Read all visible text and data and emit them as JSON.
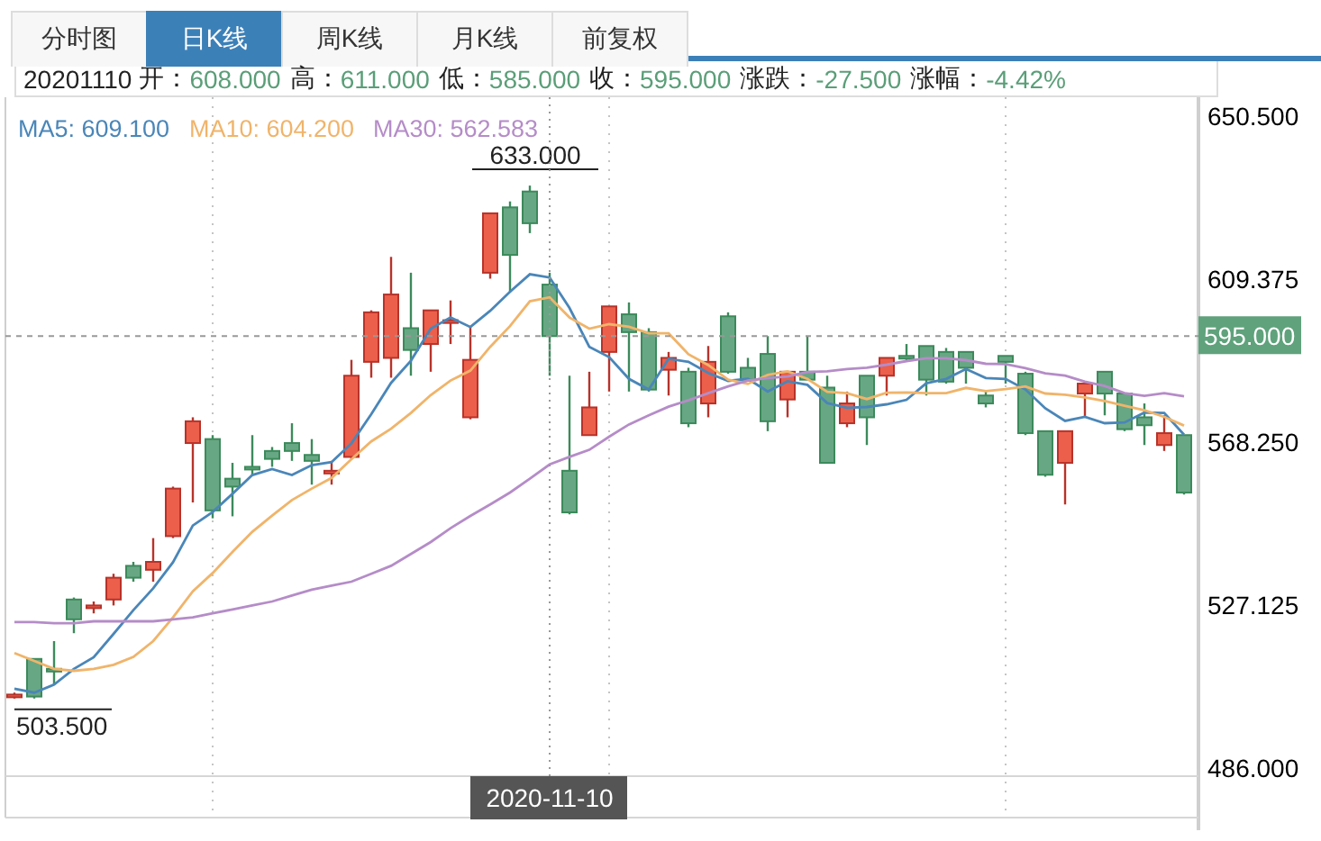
{
  "tabs": [
    {
      "label": "分时图",
      "selected": false
    },
    {
      "label": "日K线",
      "selected": true
    },
    {
      "label": "周K线",
      "selected": false
    },
    {
      "label": "月K线",
      "selected": false
    },
    {
      "label": "前复权",
      "selected": false
    }
  ],
  "quote": {
    "date": "20201110",
    "fields": [
      {
        "label": "开：",
        "value": "608.000"
      },
      {
        "label": "高：",
        "value": "611.000"
      },
      {
        "label": "低：",
        "value": "585.000"
      },
      {
        "label": "收：",
        "value": "595.000"
      },
      {
        "label": "涨跌：",
        "value": "-27.500"
      },
      {
        "label": "涨幅：",
        "value": "-4.42%"
      }
    ]
  },
  "chart": {
    "max_label": "633.000",
    "min_label": "503.500",
    "cursor_date": "2020-11-10",
    "chart_data": {
      "type": "candlestick",
      "ylim": [
        483.9,
        655.3
      ],
      "grid": true,
      "yticks": [
        {
          "value": 650.5,
          "label": "650.500"
        },
        {
          "value": 609.375,
          "label": "609.375"
        },
        {
          "value": 568.25,
          "label": "568.250"
        },
        {
          "value": 527.125,
          "label": "527.125"
        },
        {
          "value": 486,
          "label": "486.000"
        }
      ],
      "series": [
        {
          "name": "MA5: 609.100",
          "type": "line",
          "color": "#4a86b8",
          "values": [
            506,
            505,
            507,
            511,
            513.9,
            519.8,
            525.8,
            531.3,
            537.9,
            547.2,
            550.6,
            555.2,
            559.9,
            561.4,
            559.9,
            562.4,
            563.2,
            567.9,
            575.3,
            583.2,
            588.8,
            596.9,
            599.7,
            597.3,
            601.4,
            606.2,
            610.6,
            609.8,
            602.1,
            592.3,
            589.7,
            584.2,
            581.5,
            589.3,
            588.5,
            585.7,
            583.7,
            584.2,
            581,
            583.6,
            582.7,
            578.1,
            576.9,
            577.1,
            577.8,
            578.9,
            583.1,
            584.2,
            586.7,
            584.4,
            584.2,
            581.5,
            576.8,
            573.6,
            574.6,
            573,
            573.2,
            575.7,
            575.6,
            570.1
          ]
        },
        {
          "name": "MA10: 604.200",
          "type": "line",
          "color": "#f0b46a",
          "values": [
            515,
            513,
            511,
            510.5,
            511,
            512,
            514,
            518,
            524,
            530.6,
            535.2,
            540.5,
            545.6,
            549.7,
            553.6,
            556.5,
            559.2,
            563.9,
            568.4,
            571.6,
            575.6,
            580.1,
            583.8,
            586.3,
            592.3,
            597.5,
            603.8,
            604.8,
            599.7,
            596.9,
            598,
            597.4,
            595.7,
            595.7,
            590.4,
            587.7,
            584,
            582.9,
            585.2,
            586.1,
            584.2,
            580.9,
            580.6,
            579.1,
            580.7,
            580.8,
            580.6,
            580.6,
            581.9,
            581.1,
            581.6,
            582.3,
            580.5,
            580.2,
            579.5,
            578.6,
            577.4,
            576.3,
            574.6,
            572.4
          ]
        },
        {
          "name": "MA30: 562.583",
          "type": "line",
          "color": "#b58cc8",
          "values": [
            522.8,
            522.8,
            522.5,
            522.5,
            523,
            523,
            523,
            523,
            523.5,
            524,
            525,
            526,
            527,
            528,
            529.5,
            531,
            532,
            533,
            535,
            537,
            540,
            543,
            546.5,
            549.6,
            552.5,
            555.5,
            559,
            562.6,
            564.5,
            566.3,
            569.6,
            572.7,
            575,
            577.2,
            578.8,
            580.6,
            582.3,
            583.8,
            584.4,
            584.8,
            585.9,
            586.1,
            586.7,
            587,
            587.8,
            588.7,
            589.4,
            589.4,
            588.9,
            588,
            587.9,
            586.9,
            585.6,
            585,
            583.5,
            582.4,
            580.6,
            579.9,
            580.6,
            579.8
          ]
        }
      ],
      "ohlc": [
        [
          504,
          505,
          503.5,
          504.5
        ],
        [
          513.5,
          513.5,
          503.5,
          504
        ],
        [
          511,
          518,
          507,
          510.5
        ],
        [
          528.5,
          529,
          520,
          523.5
        ],
        [
          526.5,
          528,
          525,
          527
        ],
        [
          528.5,
          535,
          527,
          534
        ],
        [
          537,
          538,
          533,
          534
        ],
        [
          536,
          544,
          533,
          538
        ],
        [
          544.5,
          557,
          544,
          556.5
        ],
        [
          568,
          574.5,
          553,
          573.5
        ],
        [
          569,
          570,
          549,
          551
        ],
        [
          559,
          563,
          549.5,
          557
        ],
        [
          562,
          570,
          560,
          561.5
        ],
        [
          566,
          567,
          562,
          564
        ],
        [
          568,
          573,
          563.5,
          566
        ],
        [
          565,
          569,
          557.5,
          563.5
        ],
        [
          560.5,
          563.5,
          557.5,
          561
        ],
        [
          564.5,
          589,
          564,
          585
        ],
        [
          588.5,
          601.5,
          584.5,
          601
        ],
        [
          589.5,
          615,
          584.5,
          605.5
        ],
        [
          597,
          611,
          585,
          591.5
        ],
        [
          593,
          601.5,
          586,
          601.5
        ],
        [
          598.5,
          604,
          593,
          599
        ],
        [
          574.5,
          597.5,
          574,
          589
        ],
        [
          611,
          626,
          609.5,
          626
        ],
        [
          627.5,
          629,
          606,
          615.5
        ],
        [
          631.5,
          633,
          621,
          623.5
        ],
        [
          608,
          611,
          585,
          595
        ],
        [
          561,
          585,
          550,
          550.5
        ],
        [
          570,
          586,
          570,
          577
        ],
        [
          591,
          602.5,
          581,
          602.5
        ],
        [
          600.5,
          603.5,
          581,
          596
        ],
        [
          596,
          597,
          581,
          581.5
        ],
        [
          586.5,
          591,
          580,
          589.5
        ],
        [
          586,
          587,
          572,
          573
        ],
        [
          578,
          592.5,
          574.5,
          588.5
        ],
        [
          600,
          601,
          585.5,
          586
        ],
        [
          587,
          589.5,
          583.5,
          584
        ],
        [
          590.5,
          595,
          571,
          573.5
        ],
        [
          579,
          586,
          574.5,
          586
        ],
        [
          586,
          595,
          584,
          584
        ],
        [
          582,
          585,
          563,
          563
        ],
        [
          573,
          581,
          572,
          578
        ],
        [
          585,
          585,
          567.5,
          574.5
        ],
        [
          585,
          589.5,
          580,
          589.5
        ],
        [
          590,
          593,
          588.5,
          589.5
        ],
        [
          592.5,
          592.5,
          580,
          584
        ],
        [
          591,
          592,
          583,
          583.5
        ],
        [
          591,
          591,
          583,
          587
        ],
        [
          580,
          581,
          577,
          578
        ],
        [
          590,
          590,
          583,
          588.5
        ],
        [
          585.5,
          586,
          570,
          570.5
        ],
        [
          571,
          571,
          559.5,
          560
        ],
        [
          563,
          571,
          552.5,
          571
        ],
        [
          580.5,
          583,
          574.5,
          583
        ],
        [
          586,
          586,
          575,
          580.5
        ],
        [
          580.5,
          580.5,
          571,
          571.5
        ],
        [
          574.5,
          578,
          567.5,
          572.5
        ],
        [
          567.5,
          575,
          566,
          570.5
        ],
        [
          570,
          570,
          555,
          555.5
        ]
      ],
      "ref_lines": [
        {
          "axis": "y",
          "value": 595,
          "label": "595.000"
        }
      ]
    }
  }
}
